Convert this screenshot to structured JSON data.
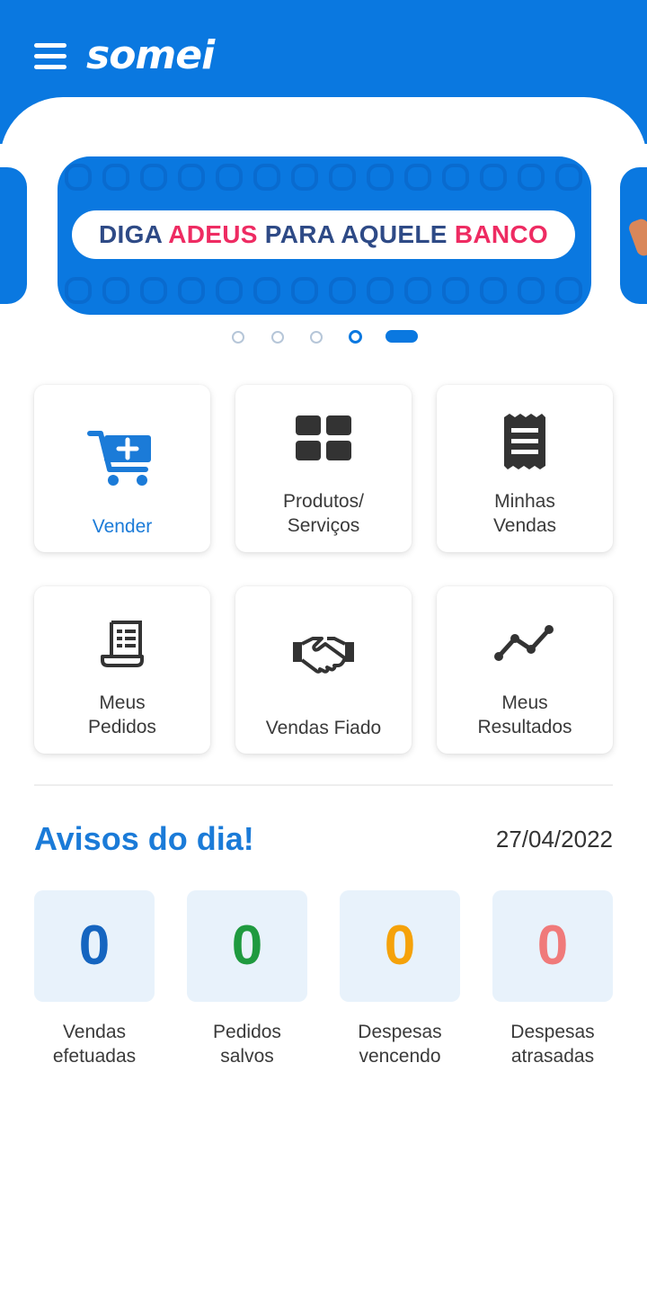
{
  "header": {
    "logo_text": "somei",
    "menu_icon": "hamburger-menu-icon",
    "background": "#0a78e0"
  },
  "banner": {
    "text_part1": "DIGA ",
    "text_highlight1": "ADEUS",
    "text_part2": " PARA AQUELE ",
    "text_highlight2": "BANCO",
    "highlight_color": "#ee2b62"
  },
  "carousel": {
    "total": 5,
    "active_index": 4
  },
  "menu_cards": [
    {
      "label": "Vender",
      "icon": "cart-plus-icon",
      "color": "#1b7bd8"
    },
    {
      "label": "Produtos/\nServiços",
      "icon": "grid-icon"
    },
    {
      "label": "Minhas\nVendas",
      "icon": "receipt-icon"
    },
    {
      "label": "Meus\nPedidos",
      "icon": "order-scroll-icon"
    },
    {
      "label": "Vendas Fiado",
      "icon": "handshake-icon"
    },
    {
      "label": "Meus\nResultados",
      "icon": "trend-line-icon"
    }
  ],
  "avisos": {
    "title": "Avisos do dia!",
    "date": "27/04/2022",
    "stats": [
      {
        "value": "0",
        "label": "Vendas\nefetuadas",
        "color": "#1565c0"
      },
      {
        "value": "0",
        "label": "Pedidos\nsalvos",
        "color": "#1f9a3f"
      },
      {
        "value": "0",
        "label": "Despesas\nvencendo",
        "color": "#f5a20a"
      },
      {
        "value": "0",
        "label": "Despesas\natrasadas",
        "color": "#f07a7a"
      }
    ]
  }
}
